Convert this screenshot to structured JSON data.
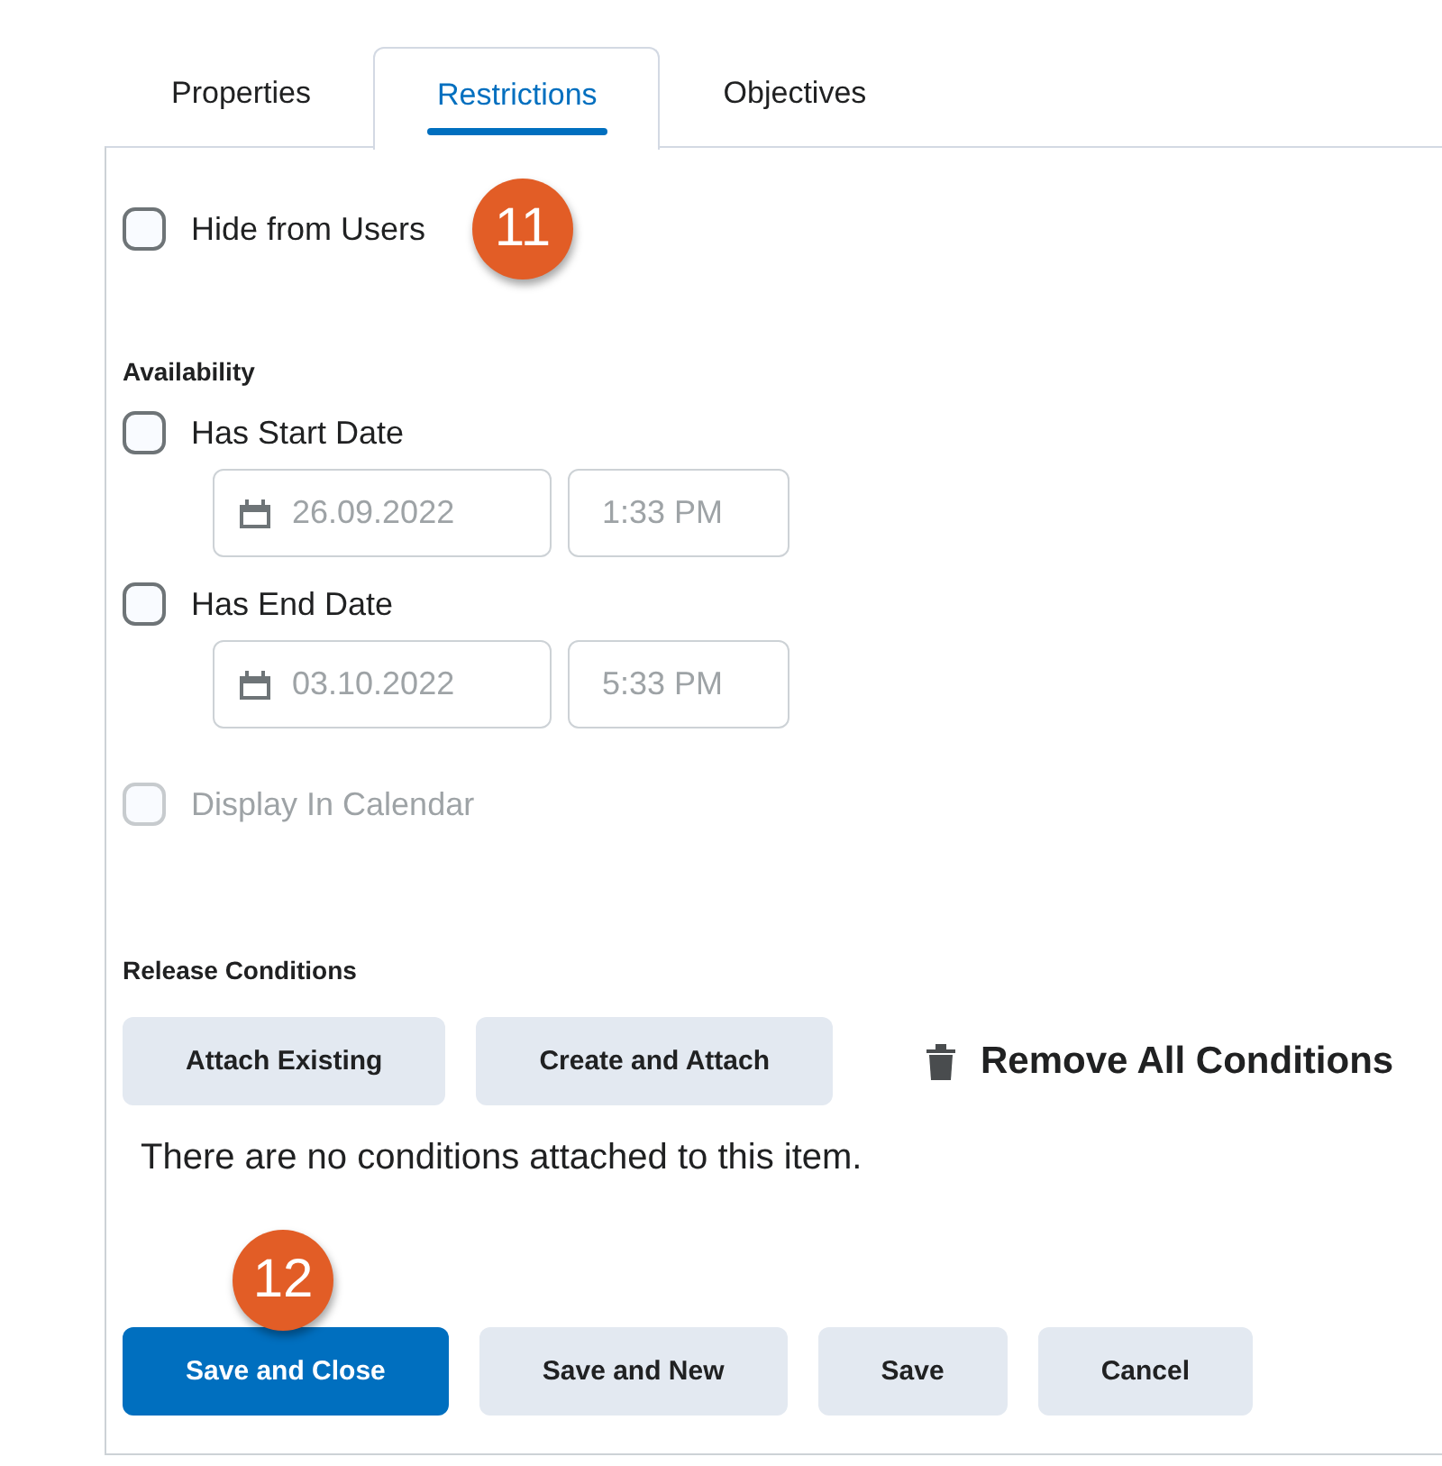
{
  "tabs": [
    {
      "label": "Properties",
      "selected": false
    },
    {
      "label": "Restrictions",
      "selected": true
    },
    {
      "label": "Objectives",
      "selected": false
    }
  ],
  "hide_from_users": {
    "label": "Hide from Users",
    "checked": false
  },
  "availability": {
    "heading": "Availability",
    "dates": [
      {
        "label": "Has Start Date",
        "checked": false,
        "date": "26.09.2022",
        "time": "1:33 PM"
      },
      {
        "label": "Has End Date",
        "checked": false,
        "date": "03.10.2022",
        "time": "5:33 PM"
      }
    ],
    "display_in_calendar": {
      "label": "Display In Calendar",
      "checked": false,
      "disabled": true
    }
  },
  "release_conditions": {
    "heading": "Release Conditions",
    "buttons": [
      "Attach Existing",
      "Create and Attach"
    ],
    "remove_all": "Remove All Conditions",
    "message": "There are no conditions attached to this item."
  },
  "footer_buttons": [
    {
      "label": "Save and Close",
      "kind": "primary"
    },
    {
      "label": "Save and New",
      "kind": "secondary"
    },
    {
      "label": "Save",
      "kind": "secondary"
    },
    {
      "label": "Cancel",
      "kind": "secondary"
    }
  ],
  "callouts": [
    "11",
    "12"
  ]
}
